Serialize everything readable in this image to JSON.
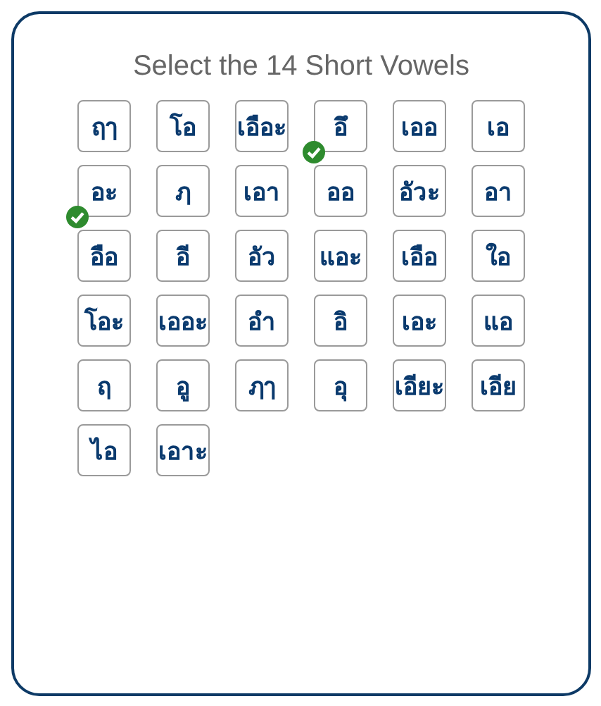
{
  "title": "Select the 14 Short Vowels",
  "tiles": [
    {
      "text": "ฤๅ",
      "selected": false
    },
    {
      "text": "โอ",
      "selected": false
    },
    {
      "text": "เอือะ",
      "selected": false
    },
    {
      "text": "อึ",
      "selected": true
    },
    {
      "text": "เออ",
      "selected": false
    },
    {
      "text": "เอ",
      "selected": false
    },
    {
      "text": "อะ",
      "selected": true
    },
    {
      "text": "ฦ",
      "selected": false
    },
    {
      "text": "เอา",
      "selected": false
    },
    {
      "text": "ออ",
      "selected": false
    },
    {
      "text": "อัวะ",
      "selected": false
    },
    {
      "text": "อา",
      "selected": false
    },
    {
      "text": "อือ",
      "selected": false
    },
    {
      "text": "อี",
      "selected": false
    },
    {
      "text": "อัว",
      "selected": false
    },
    {
      "text": "แอะ",
      "selected": false
    },
    {
      "text": "เอือ",
      "selected": false
    },
    {
      "text": "ใอ",
      "selected": false
    },
    {
      "text": "โอะ",
      "selected": false
    },
    {
      "text": "เออะ",
      "selected": false
    },
    {
      "text": "อำ",
      "selected": false
    },
    {
      "text": "อิ",
      "selected": false
    },
    {
      "text": "เอะ",
      "selected": false
    },
    {
      "text": "แอ",
      "selected": false
    },
    {
      "text": "ฤ",
      "selected": false
    },
    {
      "text": "อู",
      "selected": false
    },
    {
      "text": "ฦๅ",
      "selected": false
    },
    {
      "text": "อุ",
      "selected": false
    },
    {
      "text": "เอียะ",
      "selected": false
    },
    {
      "text": "เอีย",
      "selected": false
    },
    {
      "text": "ไอ",
      "selected": false
    },
    {
      "text": "เอาะ",
      "selected": false
    }
  ]
}
